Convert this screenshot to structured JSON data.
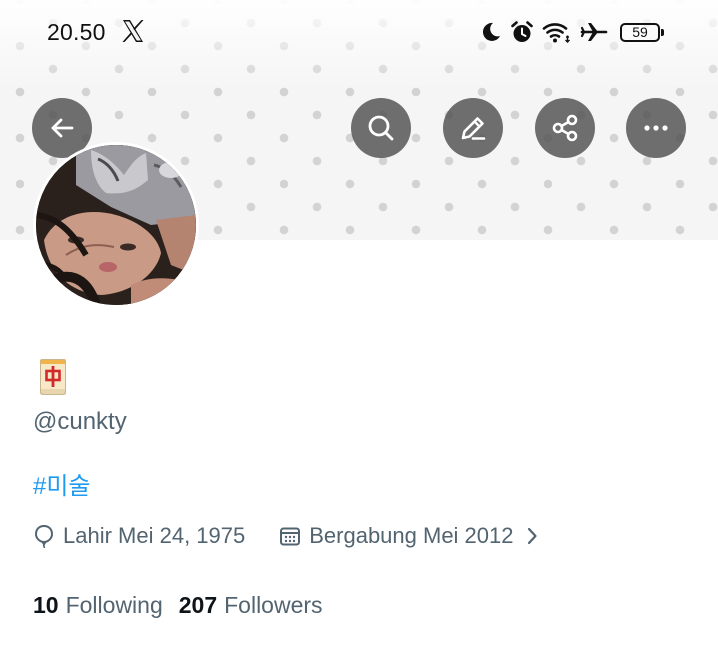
{
  "status_bar": {
    "time": "20.50",
    "app_icon": "x-logo-icon",
    "icons": [
      "moon-icon",
      "alarm-icon",
      "wifi-icon",
      "airplane-icon"
    ],
    "battery": "59"
  },
  "header": {
    "buttons": [
      "back-arrow-icon",
      "search-icon",
      "edit-icon",
      "share-icon",
      "more-icon"
    ]
  },
  "profile": {
    "name_emoji": "mahjong-red-dragon-icon",
    "handle": "@cunkty",
    "bio_hashtag": "#미술",
    "birth": "Lahir Mei 24, 1975",
    "joined": "Bergabung Mei 2012",
    "following_count": "10",
    "following_label": "Following",
    "followers_count": "207",
    "followers_label": "Followers"
  },
  "colors": {
    "accent": "#1d9bf0",
    "secondary_text": "#536471",
    "primary_text": "#0f1419",
    "button_overlay": "#505050"
  }
}
